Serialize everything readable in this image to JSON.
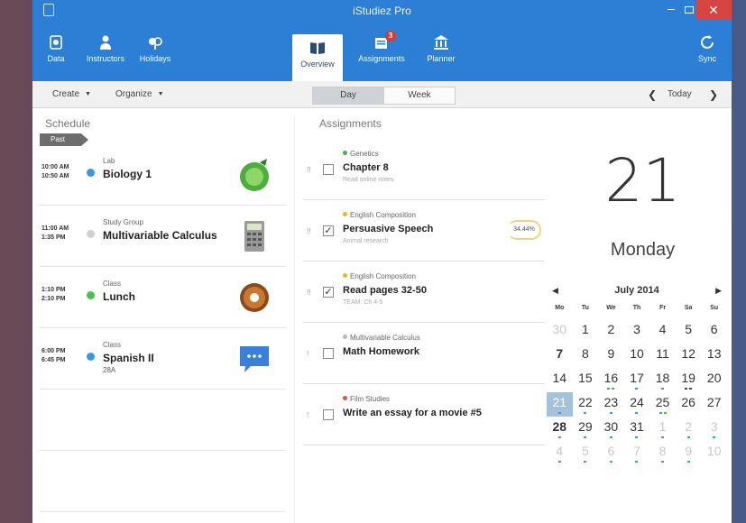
{
  "window": {
    "title": "iStudiez Pro"
  },
  "ribbon": {
    "left": [
      {
        "label": "Data",
        "icon": "database-icon"
      },
      {
        "label": "Instructors",
        "icon": "person-icon"
      },
      {
        "label": "Holidays",
        "icon": "holiday-icon"
      }
    ],
    "center": [
      {
        "label": "Overview",
        "icon": "book-icon",
        "active": true
      },
      {
        "label": "Assignments",
        "icon": "assignments-icon",
        "badge": "3"
      },
      {
        "label": "Planner",
        "icon": "building-icon"
      }
    ],
    "sync": {
      "label": "Sync",
      "icon": "sync-icon"
    }
  },
  "toolbar": {
    "create": "Create",
    "organize": "Organize",
    "view_day": "Day",
    "view_week": "Week",
    "prev": "❮",
    "today": "Today",
    "next": "❯"
  },
  "schedule": {
    "heading": "Schedule",
    "past_label": "Past",
    "items": [
      {
        "start": "10:00 AM",
        "end": "10:50 AM",
        "kind": "Lab",
        "name": "Biology 1",
        "room": "",
        "dot_color": "#3a9ad9",
        "pic": "biology-picture"
      },
      {
        "start": "11:00 AM",
        "end": "1:35 PM",
        "kind": "Study Group",
        "name": "Multivariable Calculus",
        "room": "",
        "dot_color": "#d0d0d0",
        "pic": "calculator-picture"
      },
      {
        "start": "1:10 PM",
        "end": "2:10 PM",
        "kind": "Class",
        "name": "Lunch",
        "room": "",
        "dot_color": "#4cc04c",
        "pic": "donut-picture"
      },
      {
        "start": "6:00 PM",
        "end": "6:45 PM",
        "kind": "Class",
        "name": "Spanish II",
        "room": "28A",
        "dot_color": "#3a9ad9",
        "pic": "speech-bubble-picture"
      }
    ]
  },
  "assignments": {
    "heading": "Assignments",
    "items": [
      {
        "course": "Genetics",
        "course_color": "#4cb050",
        "title": "Chapter 8",
        "note": "Read online notes",
        "checked": false,
        "percent": ""
      },
      {
        "course": "English Composition",
        "course_color": "#f0b429",
        "title": "Persuasive Speech",
        "note": "Animal research",
        "checked": true,
        "percent": "34.44%"
      },
      {
        "course": "English Composition",
        "course_color": "#f0b429",
        "title": "Read pages 32-50",
        "note": "TEAM: Ch 4-5",
        "checked": true,
        "percent": ""
      },
      {
        "course": "Multivariable Calculus",
        "course_color": "#b8b8b8",
        "title": "Math Homework",
        "note": "",
        "checked": false,
        "percent": ""
      },
      {
        "course": "Film Studies",
        "course_color": "#d9534f",
        "title": "Write an essay for a movie #5",
        "note": "",
        "checked": false,
        "percent": ""
      }
    ]
  },
  "date_panel": {
    "day_number": "21",
    "weekday": "Monday",
    "month_title": "July 2014",
    "prev": "◀",
    "next": "▶",
    "dow": [
      "Mo",
      "Tu",
      "We",
      "Th",
      "Fr",
      "Sa",
      "Su"
    ],
    "weeks": [
      [
        {
          "d": "30",
          "o": true
        },
        {
          "d": "1"
        },
        {
          "d": "2"
        },
        {
          "d": "3"
        },
        {
          "d": "4"
        },
        {
          "d": "5"
        },
        {
          "d": "6"
        }
      ],
      [
        {
          "d": "7",
          "b": true
        },
        {
          "d": "8"
        },
        {
          "d": "9"
        },
        {
          "d": "10"
        },
        {
          "d": "11"
        },
        {
          "d": "12"
        },
        {
          "d": "13"
        }
      ],
      [
        {
          "d": "14"
        },
        {
          "d": "15"
        },
        {
          "d": "16",
          "m": [
            "#3aa0c8",
            "#4cc04c"
          ]
        },
        {
          "d": "17",
          "m": [
            "#3aa0c8"
          ]
        },
        {
          "d": "18",
          "m": [
            "#3aa0c8"
          ]
        },
        {
          "d": "19",
          "m": [
            "#2d4b9a",
            "#2d4b9a"
          ]
        },
        {
          "d": "20"
        }
      ],
      [
        {
          "d": "21",
          "s": true,
          "m": [
            "#3aa0c8"
          ]
        },
        {
          "d": "22",
          "m": [
            "#3aa0c8"
          ]
        },
        {
          "d": "23",
          "m": [
            "#3aa0c8"
          ]
        },
        {
          "d": "24",
          "m": [
            "#3aa0c8"
          ]
        },
        {
          "d": "25",
          "m": [
            "#3aa0c8",
            "#4cc04c"
          ]
        },
        {
          "d": "26"
        },
        {
          "d": "27"
        }
      ],
      [
        {
          "d": "28",
          "b": true,
          "m": [
            "#3aa0c8"
          ]
        },
        {
          "d": "29",
          "m": [
            "#3aa0c8"
          ]
        },
        {
          "d": "30",
          "m": [
            "#3aa0c8"
          ]
        },
        {
          "d": "31",
          "m": [
            "#3aa0c8"
          ]
        },
        {
          "d": "1",
          "o": true,
          "m": [
            "#3aa0c8"
          ]
        },
        {
          "d": "2",
          "o": true,
          "m": [
            "#3aa0c8"
          ]
        },
        {
          "d": "3",
          "o": true,
          "m": [
            "#3aa0c8"
          ]
        }
      ],
      [
        {
          "d": "4",
          "o": true,
          "m": [
            "#3aa0c8"
          ]
        },
        {
          "d": "5",
          "o": true,
          "m": [
            "#3aa0c8"
          ]
        },
        {
          "d": "6",
          "o": true,
          "m": [
            "#4cc04c"
          ]
        },
        {
          "d": "7",
          "o": true,
          "m": [
            "#3aa0c8"
          ]
        },
        {
          "d": "8",
          "o": true,
          "m": [
            "#3aa0c8"
          ]
        },
        {
          "d": "9",
          "o": true,
          "m": [
            "#3aa0c8"
          ]
        },
        {
          "d": "10",
          "o": true
        }
      ]
    ]
  },
  "colors": {
    "ribbon": "#2d7fd5",
    "close": "#d64541",
    "selected_day": "#a3c3dc"
  }
}
